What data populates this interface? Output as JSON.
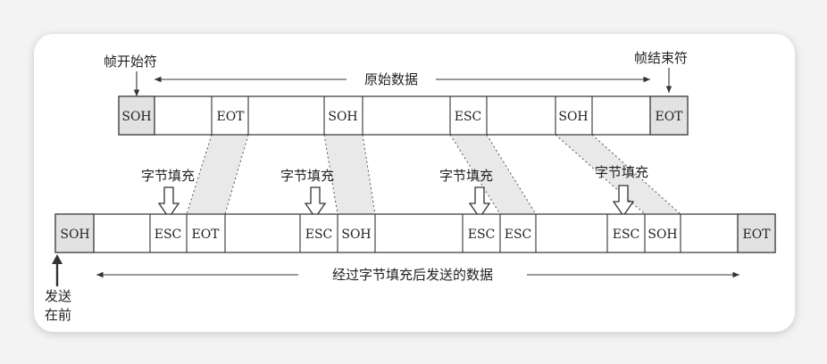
{
  "labels": {
    "frame_start": "帧开始符",
    "frame_end": "帧结束符",
    "raw_data": "原始数据",
    "byte_stuffing": "字节填充",
    "stuffed_data": "经过字节填充后发送的数据",
    "send_first_line1": "发送",
    "send_first_line2": "在前"
  },
  "top_frame": [
    "SOH",
    "",
    "EOT",
    "",
    "SOH",
    "",
    "ESC",
    "",
    "SOH",
    "",
    "EOT"
  ],
  "bottom_frame": [
    "SOH",
    "",
    "ESC",
    "EOT",
    "",
    "ESC",
    "SOH",
    "",
    "ESC",
    "ESC",
    "",
    "ESC",
    "SOH",
    "",
    "EOT"
  ]
}
